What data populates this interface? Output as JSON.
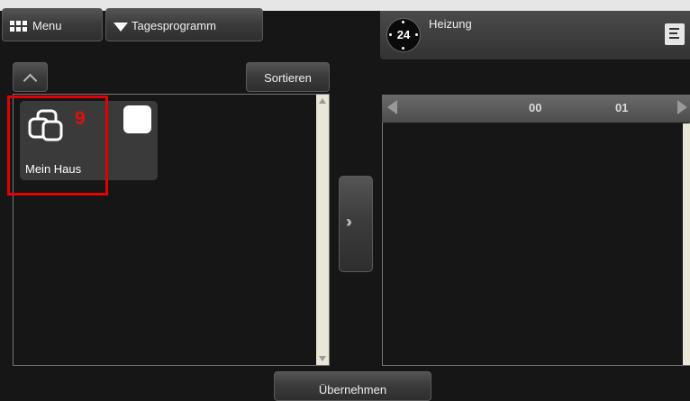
{
  "toolbar": {
    "menu_label": "Menu",
    "program_label": "Tagesprogramm"
  },
  "header": {
    "clock_number": "24",
    "title": "Heizung"
  },
  "left": {
    "sort_label": "Sortieren",
    "tiles": [
      {
        "label": "Mein Haus",
        "count": "9"
      }
    ]
  },
  "timeline": {
    "hours": [
      "00",
      "01"
    ]
  },
  "footer": {
    "apply_label": "Übernehmen"
  },
  "colors": {
    "highlight": "#e00000",
    "badge": "#e01010"
  }
}
